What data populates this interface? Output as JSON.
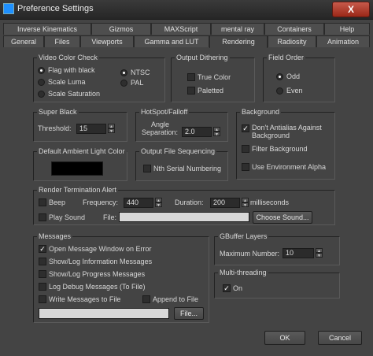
{
  "window": {
    "title": "Preference Settings",
    "close": "X"
  },
  "tabs_top": [
    "Inverse Kinematics",
    "Gizmos",
    "MAXScript",
    "mental ray",
    "Containers",
    "Help"
  ],
  "tabs_bottom": [
    "General",
    "Files",
    "Viewports",
    "Gamma and LUT",
    "Rendering",
    "Radiosity",
    "Animation"
  ],
  "video_color_check": {
    "title": "Video Color Check",
    "options": [
      "Flag with black",
      "Scale Luma",
      "Scale Saturation"
    ],
    "standards": [
      "NTSC",
      "PAL"
    ]
  },
  "output_dithering": {
    "title": "Output Dithering",
    "true_color": "True Color",
    "paletted": "Paletted"
  },
  "field_order": {
    "title": "Field Order",
    "odd": "Odd",
    "even": "Even"
  },
  "super_black": {
    "title": "Super Black",
    "threshold_label": "Threshold:",
    "threshold": "15"
  },
  "hotspot": {
    "title": "HotSpot/Falloff",
    "angle_label1": "Angle",
    "angle_label2": "Separation:",
    "value": "2.0"
  },
  "background": {
    "title": "Background",
    "antialias1": "Don't Antialias Against",
    "antialias2": "Background",
    "filter": "Filter Background",
    "env_alpha": "Use Environment Alpha"
  },
  "ambient": {
    "title": "Default Ambient Light Color",
    "color": "#000000"
  },
  "sequencing": {
    "title": "Output File Sequencing",
    "nth": "Nth Serial Numbering"
  },
  "termination": {
    "title": "Render Termination Alert",
    "beep": "Beep",
    "frequency_label": "Frequency:",
    "frequency": "440",
    "duration_label": "Duration:",
    "duration": "200",
    "ms": "milliseconds",
    "play_sound": "Play Sound",
    "file_label": "File:",
    "file_value": "",
    "choose": "Choose Sound..."
  },
  "messages": {
    "title": "Messages",
    "items": [
      "Open Message Window on Error",
      "Show/Log Information Messages",
      "Show/Log Progress Messages",
      "Log Debug Messages (To File)",
      "Write Messages to File"
    ],
    "append": "Append to File",
    "file_value": "",
    "file_btn": "File..."
  },
  "gbuffer": {
    "title": "GBuffer Layers",
    "max_label": "Maximum Number:",
    "max": "10"
  },
  "multithreading": {
    "title": "Multi-threading",
    "on": "On"
  },
  "buttons": {
    "ok": "OK",
    "cancel": "Cancel"
  }
}
